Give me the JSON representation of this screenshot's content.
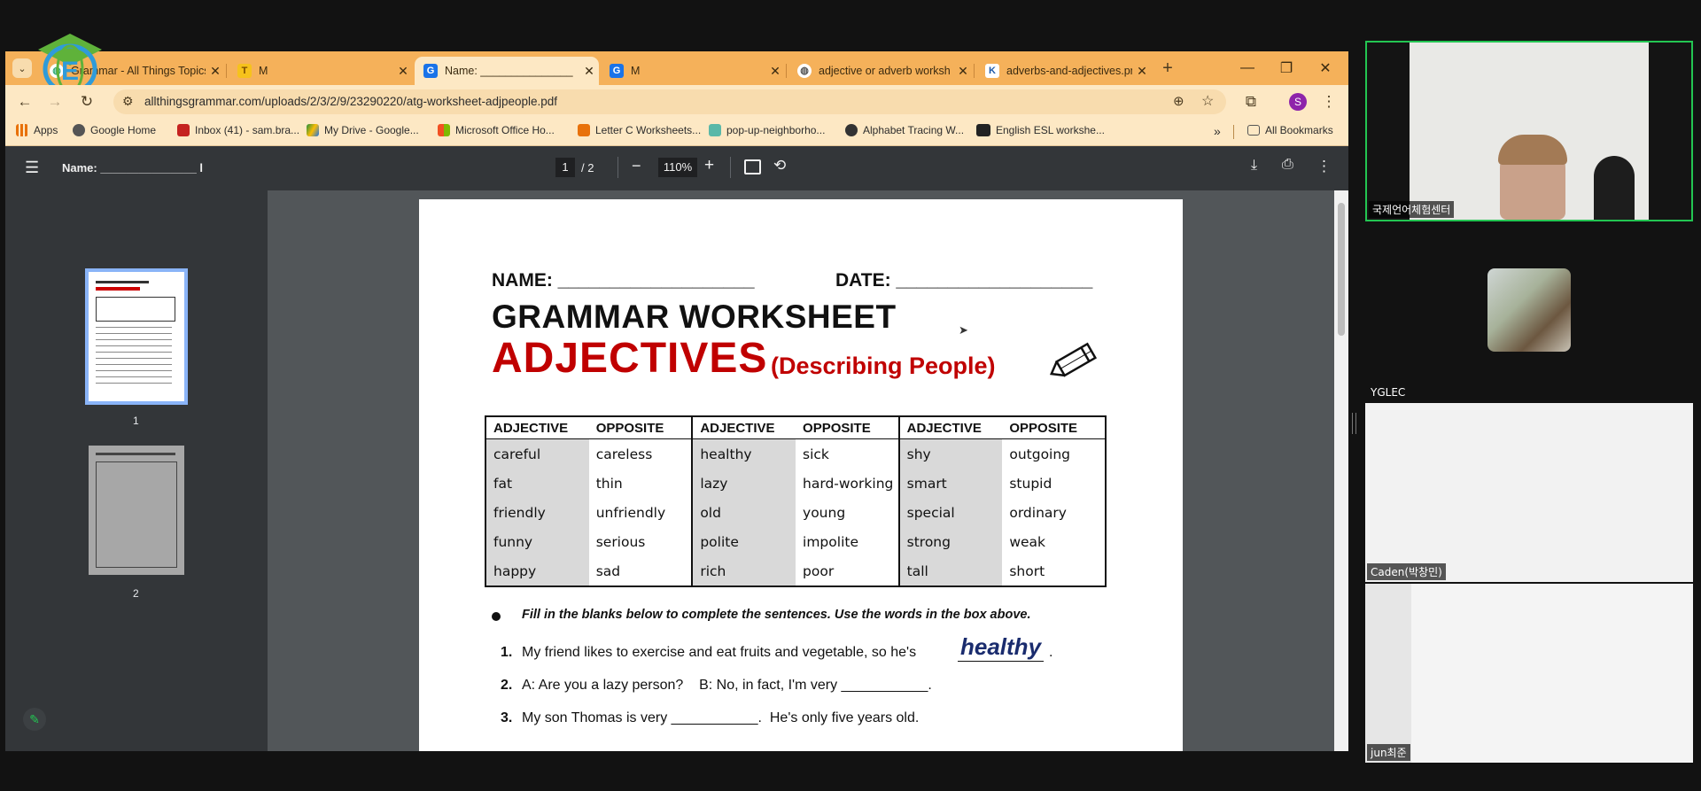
{
  "browser": {
    "tabs": [
      {
        "title": "Grammar - All Things Topics",
        "icon": "globe-icon",
        "active": false
      },
      {
        "title": "M",
        "icon": "t-icon",
        "active": false
      },
      {
        "title": "Name: _______________",
        "icon": "g-icon",
        "active": true
      },
      {
        "title": "M",
        "icon": "g-icon",
        "active": false
      },
      {
        "title": "adjective or adverb worksh",
        "icon": "globe-icon",
        "active": false
      },
      {
        "title": "adverbs-and-adjectives.pn",
        "icon": "k-icon",
        "active": false
      }
    ],
    "new_tab_label": "+",
    "url": "allthingsgrammar.com/uploads/2/3/2/9/23290220/atg-worksheet-adjpeople.pdf",
    "profile_initial": "S",
    "bookmarks": [
      {
        "label": "Apps",
        "color": "#e8710a"
      },
      {
        "label": "Google Home",
        "color": "#555555"
      },
      {
        "label": "Inbox (41) - sam.bra...",
        "color": "#c5221f"
      },
      {
        "label": "My Drive - Google...",
        "color": "#1e8e3e"
      },
      {
        "label": "Microsoft Office Ho...",
        "color": "#d83b01"
      },
      {
        "label": "Letter C Worksheets...",
        "color": "#e8710a"
      },
      {
        "label": "pop-up-neighborho...",
        "color": "#5ab8a8"
      },
      {
        "label": "Alphabet Tracing W...",
        "color": "#333333"
      },
      {
        "label": "English ESL workshe...",
        "color": "#222222"
      }
    ],
    "bookmarks_more": "»",
    "all_bookmarks": "All Bookmarks"
  },
  "pdf": {
    "title": "Name: _______________ l",
    "page_current": "1",
    "page_total": "/ 2",
    "zoom": "110%",
    "thumb_labels": [
      "1",
      "2"
    ],
    "worksheet": {
      "name_label": "NAME: ___________________",
      "date_label": "DATE: ___________________",
      "heading": "GRAMMAR WORKSHEET",
      "subheading": "ADJECTIVES",
      "subheading_paren": "(Describing People)",
      "headers": [
        "ADJECTIVE",
        "OPPOSITE",
        "ADJECTIVE",
        "OPPOSITE",
        "ADJECTIVE",
        "OPPOSITE"
      ],
      "rows": [
        [
          "careful",
          "careless",
          "healthy",
          "sick",
          "shy",
          "outgoing"
        ],
        [
          "fat",
          "thin",
          "lazy",
          "hard-working",
          "smart",
          "stupid"
        ],
        [
          "friendly",
          "unfriendly",
          "old",
          "young",
          "special",
          "ordinary"
        ],
        [
          "funny",
          "serious",
          "polite",
          "impolite",
          "strong",
          "weak"
        ],
        [
          "happy",
          "sad",
          "rich",
          "poor",
          "tall",
          "short"
        ]
      ],
      "instruction": "Fill in the blanks below to complete the sentences.  Use the words in the box above.",
      "sentences": [
        {
          "num": "1.",
          "text": "My friend likes to exercise and eat fruits and vegetable, so he's",
          "answer": "healthy",
          "end": "."
        },
        {
          "num": "2.",
          "text": "A: Are you a lazy person?    B: No, in fact, I'm very ___________.",
          "answer": "",
          "end": ""
        },
        {
          "num": "3.",
          "text": "My son Thomas is very ___________.  He's only five years old.",
          "answer": "",
          "end": ""
        }
      ]
    }
  },
  "video": {
    "participants": [
      {
        "name": "국제언어체험센터",
        "active_speaker": true
      },
      {
        "name": "YGLEC",
        "active_speaker": false
      },
      {
        "name": "Caden(박창민)",
        "active_speaker": false
      },
      {
        "name": "jun최준",
        "active_speaker": false
      }
    ],
    "accent": "#23c552"
  }
}
